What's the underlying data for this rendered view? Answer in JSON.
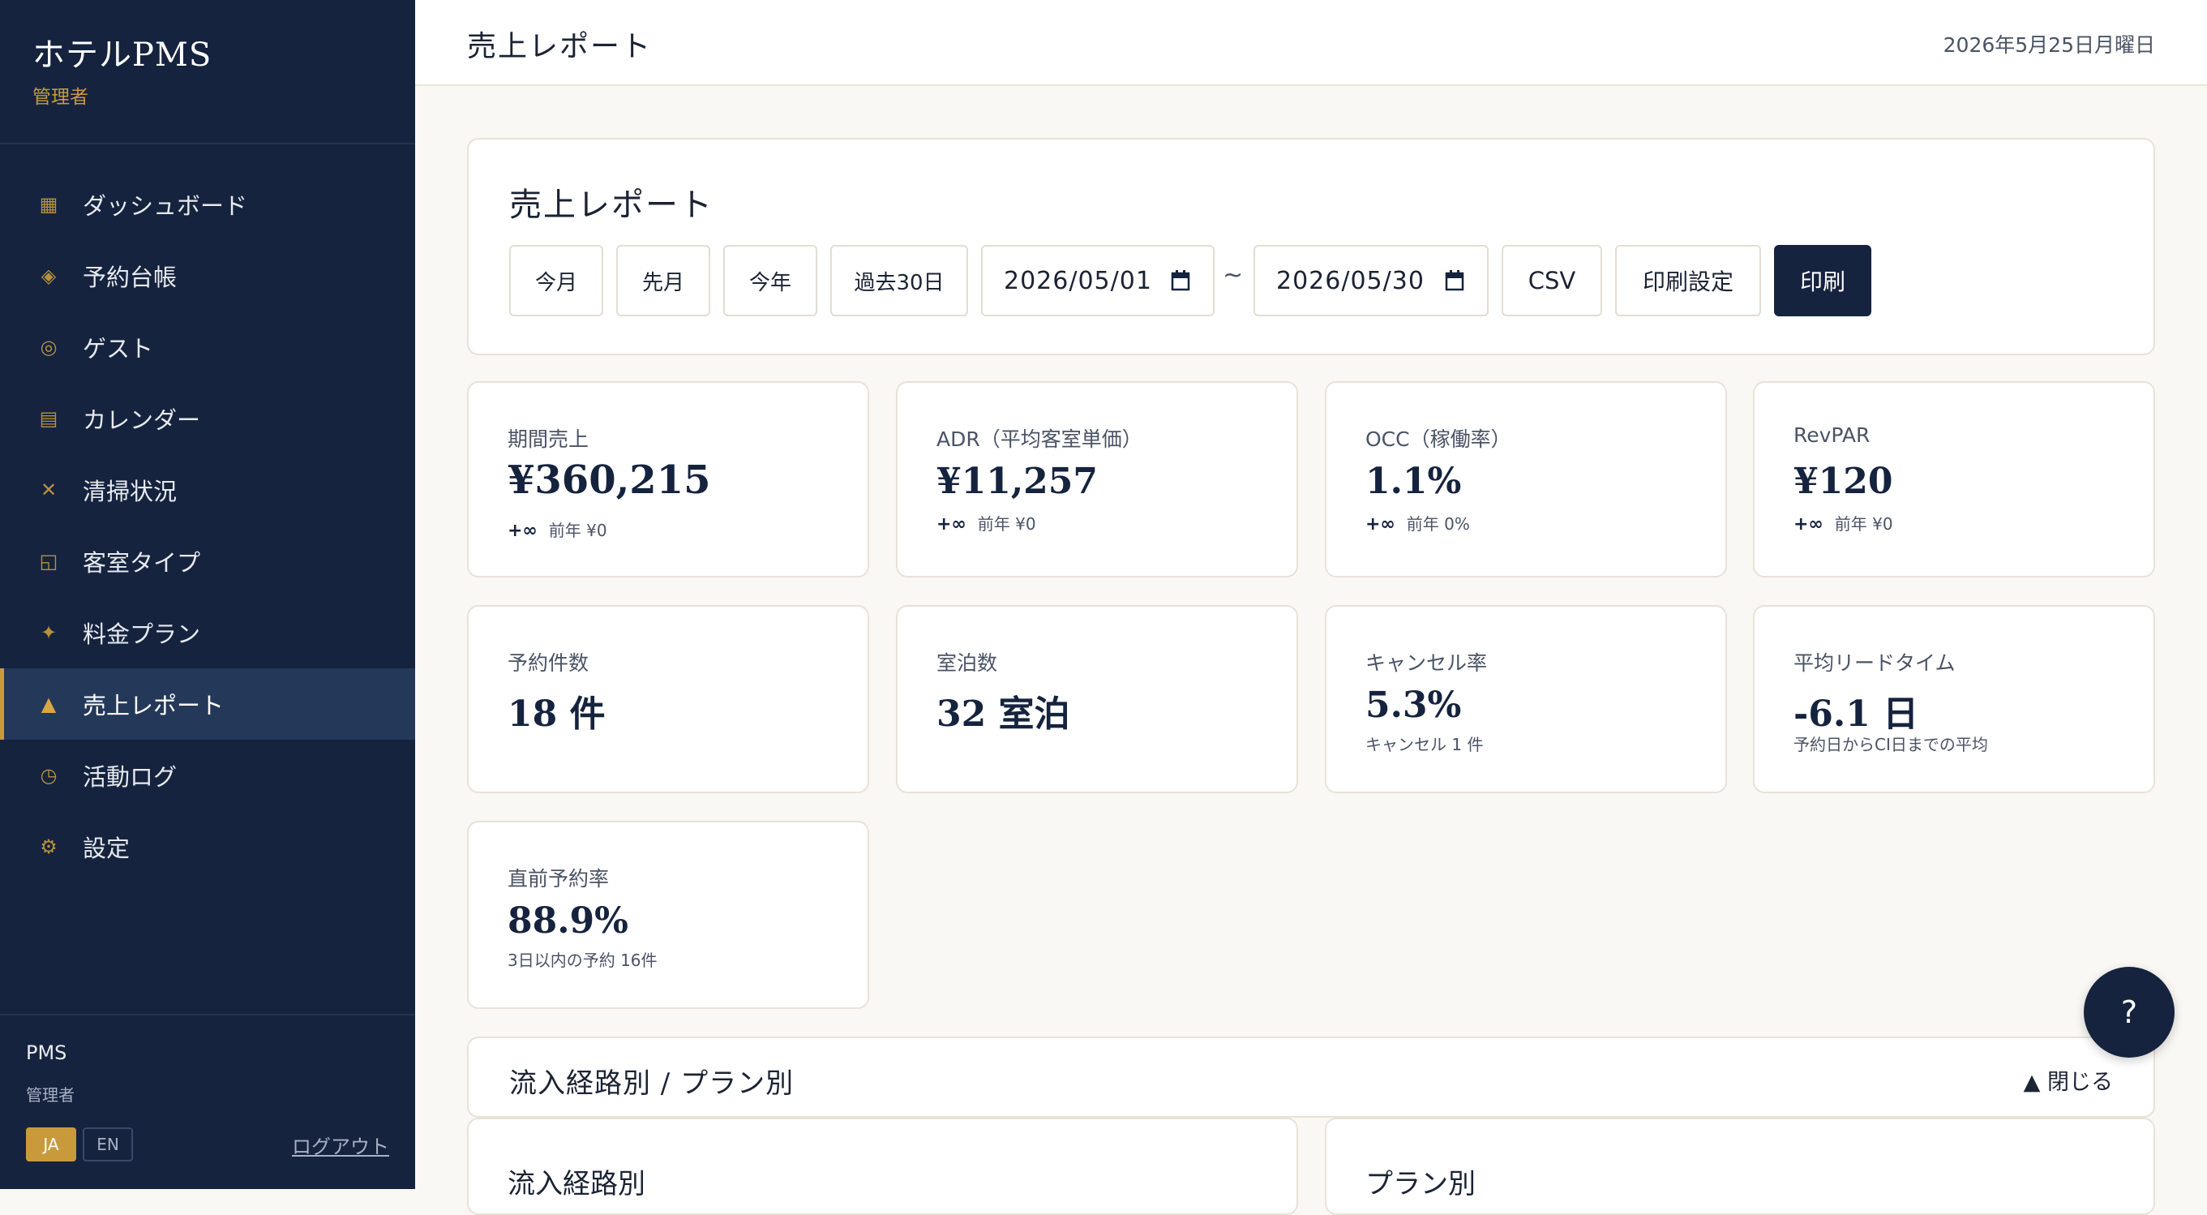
{
  "sidebar": {
    "app_name": "ホテルPMS",
    "role": "管理者",
    "items": [
      {
        "icon": "▦",
        "icon_name": "grid-icon",
        "label": "ダッシュボード"
      },
      {
        "icon": "◈",
        "icon_name": "diamond-icon",
        "label": "予約台帳"
      },
      {
        "icon": "◎",
        "icon_name": "circle-icon",
        "label": "ゲスト"
      },
      {
        "icon": "▤",
        "icon_name": "calendar-icon",
        "label": "カレンダー"
      },
      {
        "icon": "✕",
        "icon_name": "cross-icon",
        "label": "清掃状況"
      },
      {
        "icon": "◱",
        "icon_name": "room-icon",
        "label": "客室タイプ"
      },
      {
        "icon": "✦",
        "icon_name": "star-icon",
        "label": "料金プラン"
      },
      {
        "icon": "▲",
        "icon_name": "triangle-icon",
        "label": "売上レポート"
      },
      {
        "icon": "◷",
        "icon_name": "clock-icon",
        "label": "活動ログ"
      },
      {
        "icon": "⚙",
        "icon_name": "gear-icon",
        "label": "設定"
      }
    ],
    "footer": {
      "name": "PMS",
      "role": "管理者",
      "lang_ja": "JA",
      "lang_en": "EN",
      "logout": "ログアウト"
    }
  },
  "topbar": {
    "title": "売上レポート",
    "date": "2026年5月25日月曜日"
  },
  "filter": {
    "title": "売上レポート",
    "presets": [
      "今月",
      "先月",
      "今年",
      "過去30日"
    ],
    "start_date": "2026/05/01",
    "separator": "~",
    "end_date": "2026/05/30",
    "csv": "CSV",
    "print_settings": "印刷設定",
    "print": "印刷"
  },
  "kpis": [
    {
      "label": "期間売上",
      "value": "¥360,215",
      "delta": "+∞",
      "sub": "前年 ¥0"
    },
    {
      "label": "ADR（平均客室単価）",
      "value": "¥11,257",
      "delta": "+∞",
      "sub": "前年 ¥0"
    },
    {
      "label": "OCC（稼働率）",
      "value": "1.1%",
      "delta": "+∞",
      "sub": "前年 0%"
    },
    {
      "label": "RevPAR",
      "value": "¥120",
      "delta": "+∞",
      "sub": "前年 ¥0"
    },
    {
      "label": "予約件数",
      "value": "18 件",
      "sub": ""
    },
    {
      "label": "室泊数",
      "value": "32 室泊",
      "sub": ""
    },
    {
      "label": "キャンセル率",
      "value": "5.3%",
      "sub": "キャンセル 1 件"
    },
    {
      "label": "平均リードタイム",
      "value": "-6.1 日",
      "sub": "予約日からCI日までの平均"
    },
    {
      "label": "直前予約率",
      "value": "88.9%",
      "sub": "3日以内の予約 16件"
    }
  ],
  "section": {
    "title": "流入経路別 / プラン別",
    "toggle": "▲ 閉じる"
  },
  "subcards": {
    "channel": "流入経路別",
    "plan": "プラン別"
  },
  "help": "?"
}
